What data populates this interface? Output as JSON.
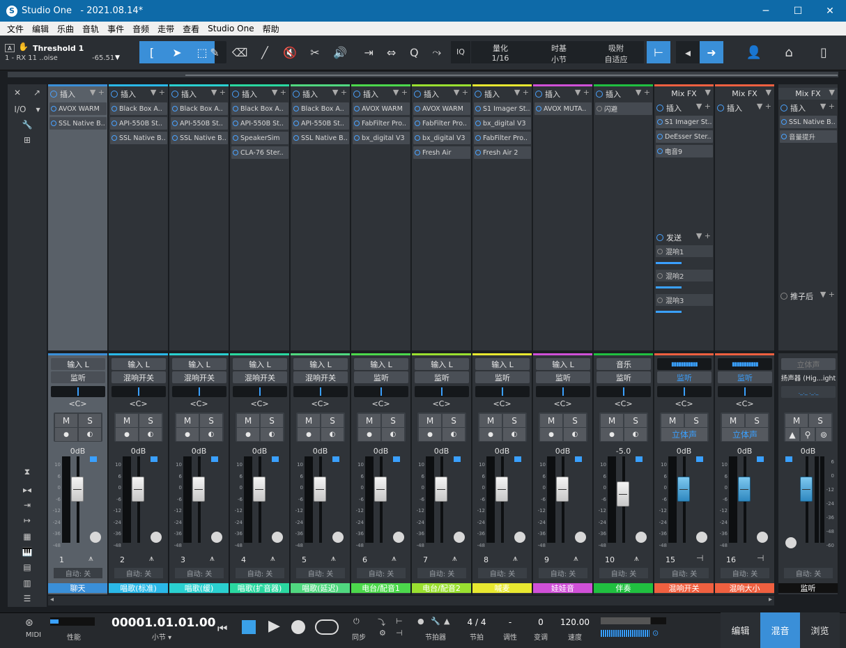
{
  "window": {
    "title": "Studio One   - 2021.08.14*",
    "minimize": "─",
    "maximize": "☐",
    "close": "✕"
  },
  "menu": [
    "文件",
    "编辑",
    "乐曲",
    "音轨",
    "事件",
    "音频",
    "走带",
    "查看",
    "Studio One",
    "帮助"
  ],
  "track_info": {
    "badge": "A",
    "name": "Threshold 1",
    "sub": "1 - RX 11 ..oise",
    "value": "-65.51"
  },
  "quantize": {
    "iq": "IQ",
    "q_label": "量化",
    "q_value": "1/16",
    "tb_label": "时基",
    "tb_value": "小节",
    "snap_label": "吸附",
    "snap_value": "自适应"
  },
  "left_panel": {
    "io": "I/O"
  },
  "channels": [
    {
      "color": "#3a8fd8",
      "name": "聊天",
      "n": "1",
      "insert_label": "插入",
      "plugins": [
        "AVOX WARM",
        "SSL Native B.."
      ],
      "in": "输入 L",
      "mon": "监听",
      "vol": "0dB",
      "selected": true
    },
    {
      "color": "#2ab8e8",
      "name": "唱歌(标准)",
      "n": "2",
      "insert_label": "插入",
      "plugins": [
        "Black Box A..",
        "API-550B St..",
        "SSL Native B.."
      ],
      "in": "输入 L",
      "mon": "混响开关",
      "vol": "0dB"
    },
    {
      "color": "#2ad0d0",
      "name": "唱歌(缓)",
      "n": "3",
      "insert_label": "插入",
      "plugins": [
        "Black Box A..",
        "API-550B St..",
        "SSL Native B.."
      ],
      "in": "输入 L",
      "mon": "混响开关",
      "vol": "0dB"
    },
    {
      "color": "#2ad8a0",
      "name": "唱歌(扩音器)",
      "n": "4",
      "insert_label": "插入",
      "plugins": [
        "Black Box A..",
        "API-550B St..",
        "SpeakerSim",
        "CLA-76 Ster.."
      ],
      "in": "输入 L",
      "mon": "混响开关",
      "vol": "0dB"
    },
    {
      "color": "#50d880",
      "name": "唱歌(延迟)",
      "n": "5",
      "insert_label": "插入",
      "plugins": [
        "Black Box A..",
        "API-550B St..",
        "SSL Native B.."
      ],
      "in": "输入 L",
      "mon": "混响开关",
      "vol": "0dB"
    },
    {
      "color": "#4cd84c",
      "name": "电台/配音1",
      "n": "6",
      "insert_label": "插入",
      "plugins": [
        "AVOX WARM",
        "FabFilter Pro..",
        "bx_digital V3"
      ],
      "in": "输入 L",
      "mon": "监听",
      "vol": "0dB"
    },
    {
      "color": "#9ae030",
      "name": "电台/配音2",
      "n": "7",
      "insert_label": "插入",
      "plugins": [
        "AVOX WARM",
        "FabFilter Pro..",
        "bx_digital V3",
        "Fresh Air"
      ],
      "in": "输入 L",
      "mon": "监听",
      "vol": "0dB"
    },
    {
      "color": "#e8e830",
      "name": "喊麦",
      "n": "8",
      "insert_label": "插入",
      "plugins": [
        "S1 Imager St..",
        "bx_digital V3",
        "FabFilter Pro..",
        "Fresh Air 2"
      ],
      "in": "输入 L",
      "mon": "监听",
      "vol": "0dB"
    },
    {
      "color": "#d050d8",
      "name": "娃娃音",
      "n": "9",
      "insert_label": "插入",
      "plugins": [
        "AVOX MUTA.."
      ],
      "in": "输入 L",
      "mon": "监听",
      "vol": "0dB"
    },
    {
      "color": "#20c040",
      "name": "伴奏",
      "n": "10",
      "insert_label": "插入",
      "plugins": [
        "闪避"
      ],
      "in": "音乐",
      "mon": "监听",
      "vol": "-5.0"
    }
  ],
  "fx_channels": [
    {
      "color": "#f06040",
      "name": "混响开关",
      "n": "15",
      "header": "Mix FX",
      "insert_label": "插入",
      "plugins": [
        "S1 Imager St..",
        "DeEsser Ster..",
        "电音9"
      ],
      "mon": "监听",
      "stereo": "立体声",
      "vol": "0dB",
      "send_label": "发送",
      "sends": [
        "混响1",
        "混响2",
        "混响3"
      ],
      "send_levels": [
        0.52,
        0.52,
        0.52
      ]
    },
    {
      "color": "#f06040",
      "name": "混响大小",
      "n": "16",
      "header": "Mix FX",
      "insert_label": "插入",
      "plugins": [],
      "mon": "监听",
      "stereo": "立体声",
      "vol": "0dB"
    }
  ],
  "main_out": {
    "header": "Mix FX",
    "insert_label": "插入",
    "plugins": [
      "SSL Native B..",
      "音量提升"
    ],
    "stereo": "立体声",
    "speaker": "扬声器 (Hig...ight",
    "post_label": "推子后",
    "vol": "0dB",
    "name": "监听"
  },
  "scale_marks": [
    "10",
    "6",
    "0",
    "-6",
    "-12",
    "-24",
    "-36",
    "-48"
  ],
  "scale_marks_main": [
    "6",
    "0",
    "-12",
    "-24",
    "-36",
    "-48",
    "-60"
  ],
  "auto_label": "自动: 关",
  "ms": {
    "m": "M",
    "s": "S"
  },
  "pan_label": "<C>",
  "transport": {
    "midi": "MIDI",
    "perf": "性能",
    "time": "00001.01.01.00",
    "time_unit": "小节",
    "sync": "同步",
    "metronome": "节拍器",
    "sig": "4 / 4",
    "sig_label": "节拍",
    "key": "-",
    "key_label": "调性",
    "transpose": "0",
    "transpose_label": "变调",
    "tempo": "120.00",
    "tempo_label": "速度"
  },
  "views": [
    "编辑",
    "混音",
    "浏览"
  ]
}
